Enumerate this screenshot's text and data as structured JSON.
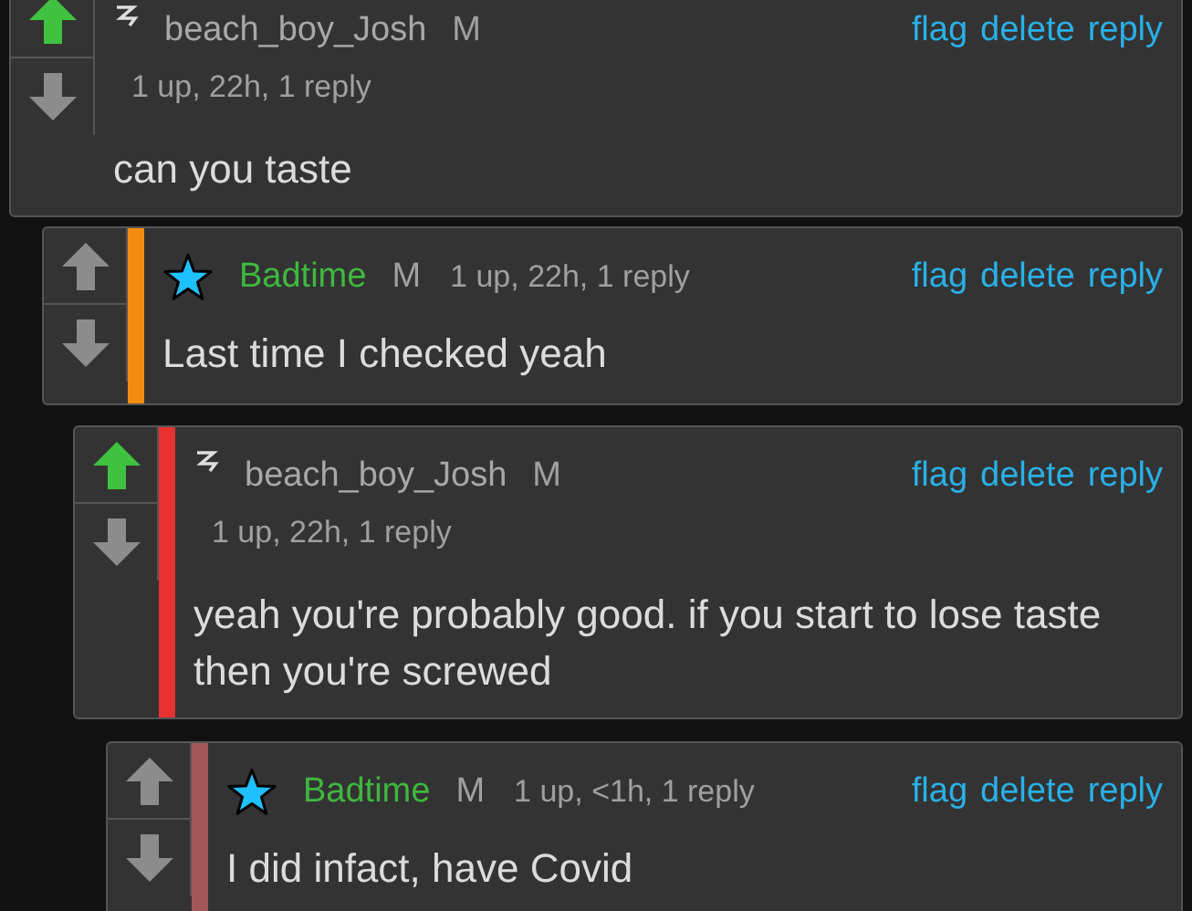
{
  "comments": [
    {
      "badge": {
        "kind": "lightning"
      },
      "user": {
        "name": "beach_boy_Josh",
        "color": "#a8a8a8"
      },
      "mod": "M",
      "meta": "1 up, 22h, 1 reply",
      "meta_inline": false,
      "upvoted": true,
      "actions": [
        "flag",
        "delete",
        "reply"
      ],
      "text": "can you taste"
    },
    {
      "badge": {
        "kind": "star"
      },
      "user": {
        "name": "Badtime",
        "color": "#3fb83f"
      },
      "mod": "M",
      "meta": "1 up, 22h, 1 reply",
      "meta_inline": true,
      "upvoted": false,
      "bar": {
        "color": "#f28c0f"
      },
      "actions": [
        "flag",
        "delete",
        "reply"
      ],
      "text": "Last time I checked yeah"
    },
    {
      "badge": {
        "kind": "lightning"
      },
      "user": {
        "name": "beach_boy_Josh",
        "color": "#a8a8a8"
      },
      "mod": "M",
      "meta": "1 up, 22h, 1 reply",
      "meta_inline": false,
      "upvoted": true,
      "bar": {
        "color": "#e83232"
      },
      "actions": [
        "flag",
        "delete",
        "reply"
      ],
      "text": "yeah you're probably good. if you start to lose taste then you're screwed"
    },
    {
      "badge": {
        "kind": "star"
      },
      "user": {
        "name": "Badtime",
        "color": "#3fb83f"
      },
      "mod": "M",
      "meta": "1 up, <1h, 1 reply",
      "meta_inline": true,
      "upvoted": false,
      "bar": {
        "color": "#a35858"
      },
      "actions": [
        "flag",
        "delete",
        "reply"
      ],
      "text": "I did infact, have Covid"
    }
  ]
}
